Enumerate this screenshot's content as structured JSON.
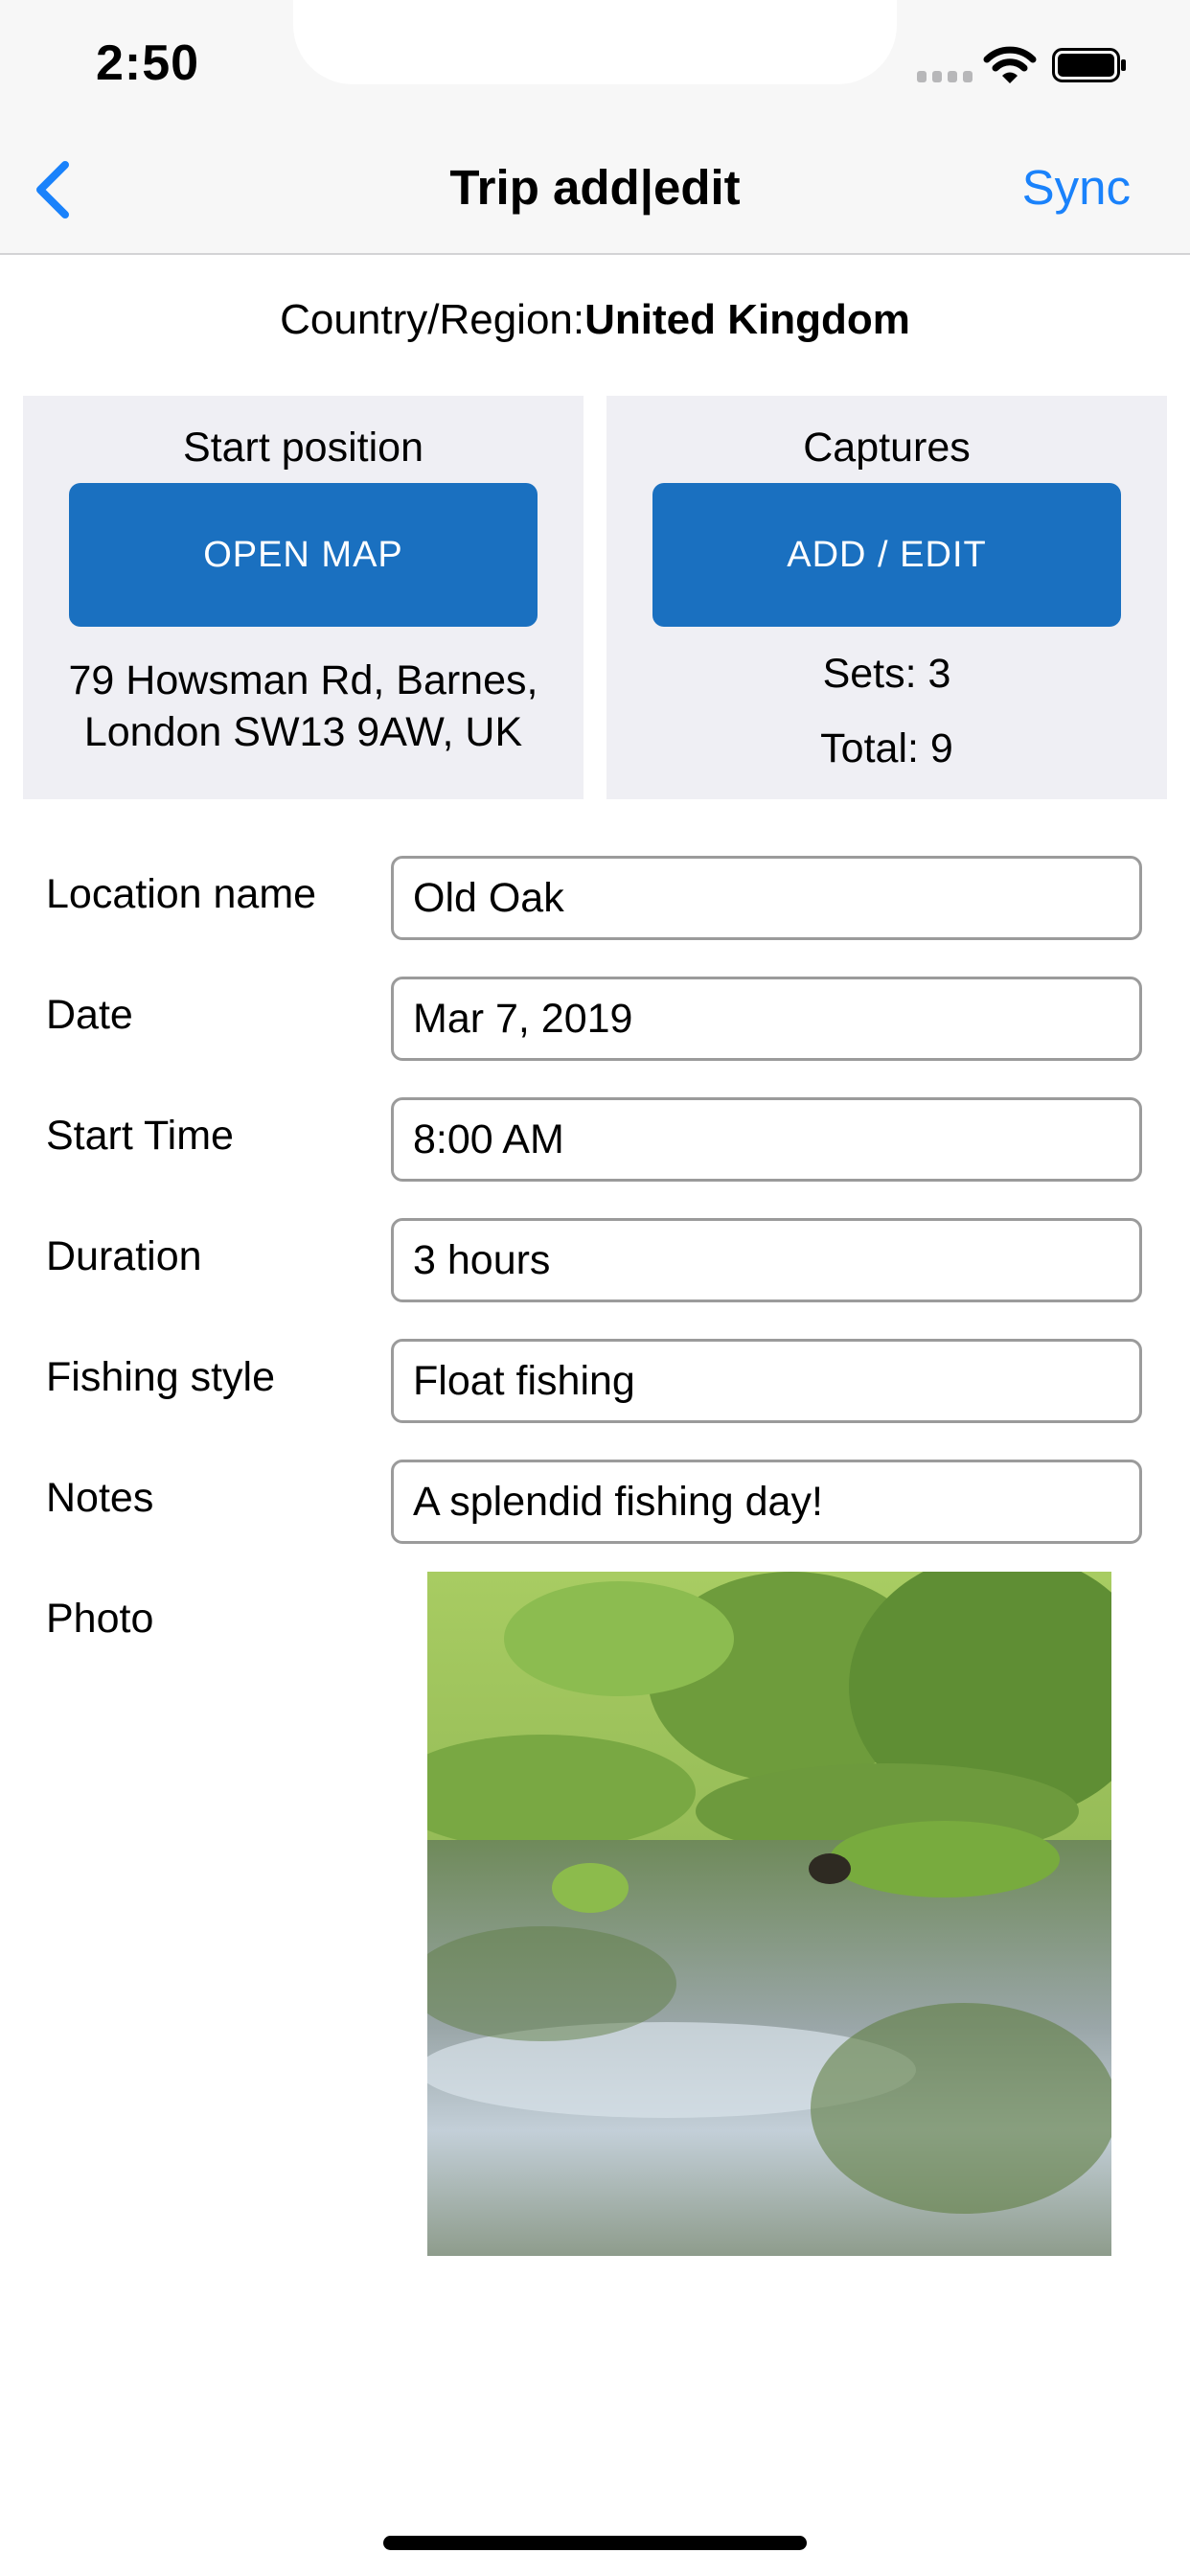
{
  "status_bar": {
    "time": "2:50",
    "icons": [
      "signal-icon",
      "wifi-icon",
      "battery-icon"
    ]
  },
  "nav": {
    "back_icon": "chevron-left-icon",
    "title": "Trip add|edit",
    "sync_label": "Sync"
  },
  "country": {
    "label": "Country/Region:",
    "value": "United Kingdom"
  },
  "start_position": {
    "title": "Start position",
    "button_label": "OPEN MAP",
    "address_line1": "79 Howsman Rd, Barnes,",
    "address_line2": "London SW13 9AW, UK"
  },
  "captures": {
    "title": "Captures",
    "button_label": "ADD / EDIT",
    "sets_label": "Sets:",
    "sets_value": "3",
    "total_label": "Total:",
    "total_value": "9"
  },
  "form": {
    "location_name": {
      "label": "Location name",
      "value": "Old Oak"
    },
    "date": {
      "label": "Date",
      "value": "Mar 7, 2019"
    },
    "start_time": {
      "label": "Start Time",
      "value": "8:00 AM"
    },
    "duration": {
      "label": "Duration",
      "value": "3 hours"
    },
    "fishing_style": {
      "label": "Fishing style",
      "value": "Float fishing"
    },
    "notes": {
      "label": "Notes",
      "value": "A splendid fishing day!"
    },
    "photo": {
      "label": "Photo"
    }
  },
  "colors": {
    "accent": "#1a82fb",
    "button_bg": "#1a70c0",
    "panel_bg": "#efeff4",
    "navbar_bg": "#f7f7f7"
  }
}
